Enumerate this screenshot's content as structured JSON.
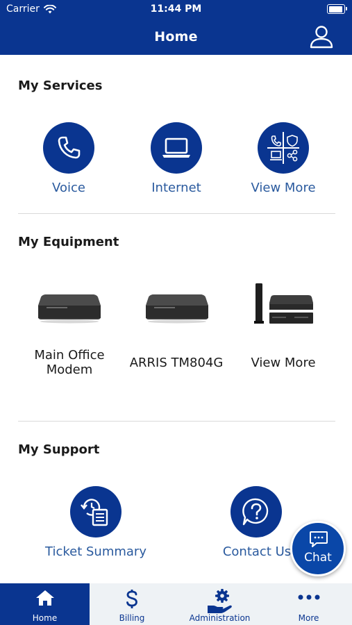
{
  "status_bar": {
    "carrier": "Carrier",
    "time": "11:44 PM"
  },
  "nav": {
    "title": "Home"
  },
  "services": {
    "title": "My Services",
    "items": [
      {
        "label": "Voice",
        "icon": "phone-icon"
      },
      {
        "label": "Internet",
        "icon": "laptop-icon"
      },
      {
        "label": "View More",
        "icon": "services-grid-icon"
      }
    ]
  },
  "equipment": {
    "title": "My Equipment",
    "items": [
      {
        "label": "Main Office Modem",
        "icon": "modem-icon"
      },
      {
        "label": "ARRIS TM804G",
        "icon": "modem-icon"
      },
      {
        "label": "View More",
        "icon": "router-stack-icon"
      }
    ]
  },
  "support": {
    "title": "My Support",
    "items": [
      {
        "label": "Ticket Summary",
        "icon": "ticket-history-icon"
      },
      {
        "label": "Contact Us",
        "icon": "question-bubble-icon"
      }
    ]
  },
  "chat": {
    "label": "Chat"
  },
  "tabs": [
    {
      "label": "Home",
      "icon": "home-icon",
      "active": true
    },
    {
      "label": "Billing",
      "icon": "dollar-icon",
      "active": false
    },
    {
      "label": "Administration",
      "icon": "admin-gear-icon",
      "active": false
    },
    {
      "label": "More",
      "icon": "more-dots-icon",
      "active": false
    }
  ],
  "colors": {
    "primary": "#0a3590",
    "label_blue": "#2a5a9e",
    "tabbar_bg": "#eef2f5"
  }
}
